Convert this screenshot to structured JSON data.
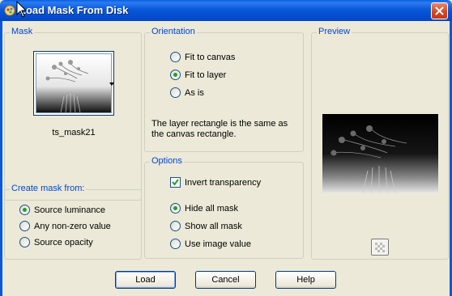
{
  "window": {
    "title": "Load Mask From Disk"
  },
  "mask": {
    "group_label": "Mask",
    "name": "ts_mask21"
  },
  "create_mask_from": {
    "group_label": "Create mask from:",
    "options": [
      {
        "label": "Source luminance",
        "selected": true
      },
      {
        "label": "Any non-zero value",
        "selected": false
      },
      {
        "label": "Source opacity",
        "selected": false
      }
    ]
  },
  "orientation": {
    "group_label": "Orientation",
    "options": [
      {
        "label": "Fit to canvas",
        "selected": false
      },
      {
        "label": "Fit to layer",
        "selected": true
      },
      {
        "label": "As is",
        "selected": false
      }
    ],
    "note": "The layer rectangle is the same as the canvas rectangle."
  },
  "options": {
    "group_label": "Options",
    "invert_transparency": {
      "label": "Invert transparency",
      "checked": true
    },
    "radios": [
      {
        "label": "Hide all mask",
        "selected": true
      },
      {
        "label": "Show all mask",
        "selected": false
      },
      {
        "label": "Use image value",
        "selected": false
      }
    ]
  },
  "preview": {
    "group_label": "Preview"
  },
  "buttons": {
    "load": "Load",
    "cancel": "Cancel",
    "help": "Help"
  },
  "colors": {
    "title_bar": "#0b58d8",
    "group_label": "#0046d5",
    "radio_selected": "#21a121",
    "close_button": "#d4451e"
  },
  "icons": [
    "app-icon",
    "cursor-icon",
    "close-icon",
    "dropdown-arrow-icon",
    "preview-toggle-icon",
    "checkmark-icon"
  ]
}
